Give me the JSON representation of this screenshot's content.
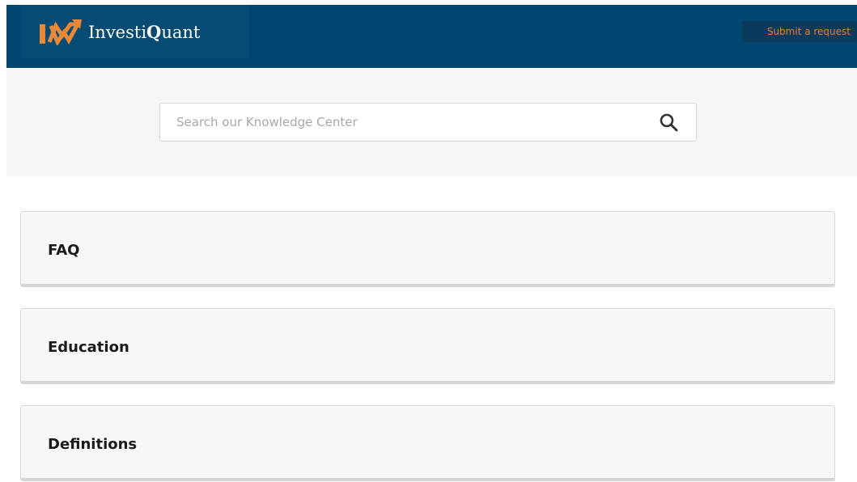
{
  "brand": {
    "name_regular": "Investi",
    "name_bold": "Q",
    "name_rest": "uant",
    "logo_colors": {
      "orange": "#e8893a",
      "background": "#054b74"
    }
  },
  "header": {
    "background": "#004670",
    "submit_request_label": "Submit a request",
    "submit_request_color": "#f07e34"
  },
  "search": {
    "placeholder": "Search our Knowledge Center",
    "value": "",
    "icon": "search-icon"
  },
  "categories": [
    {
      "label": "FAQ"
    },
    {
      "label": "Education"
    },
    {
      "label": "Definitions"
    }
  ]
}
